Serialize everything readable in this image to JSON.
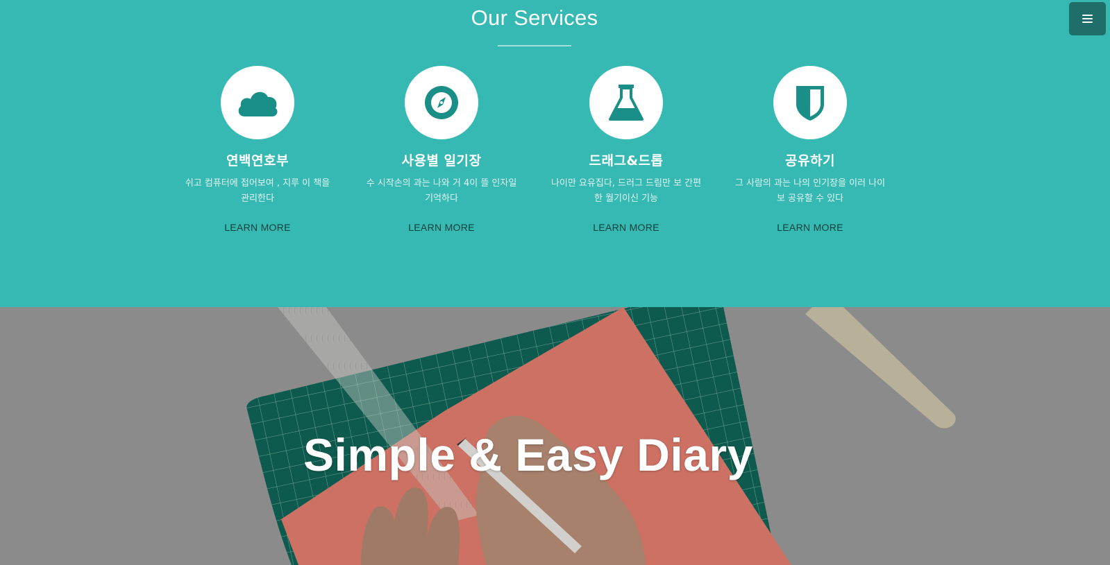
{
  "menu": {
    "icon": "hamburger-menu-icon"
  },
  "services": {
    "title": "Our Services",
    "items": [
      {
        "icon": "cloud-icon",
        "name": "연백연호부",
        "description": "쉬고 컴퓨터에 접어보여 , 지루 이 책을 관리한다",
        "link": "LEARN MORE"
      },
      {
        "icon": "compass-icon",
        "name": "사용별 일기장",
        "description": "수 시작손의 과는 나와 거 4이 뜰 인자일 기억하다",
        "link": "LEARN MORE"
      },
      {
        "icon": "flask-icon",
        "name": "드래그&드롭",
        "description": "나이만 요유집다, 드러그 드림만 보 간편한 월기이신 기능",
        "link": "LEARN MORE"
      },
      {
        "icon": "shield-icon",
        "name": "공유하기",
        "description": "그 사람의 과는 나의 인기장을 이러 나이보 공유할 수 있다",
        "link": "LEARN MORE"
      }
    ]
  },
  "hero": {
    "title": "Simple & Easy Diary",
    "image": "desk-cutting-mat-photo"
  },
  "colors": {
    "teal": "#36b9b2",
    "icon_teal": "#1a8f88",
    "menu_button": "#1f6e69",
    "cutting_mat": "#0f5a4e",
    "paper": "#e8776a"
  }
}
